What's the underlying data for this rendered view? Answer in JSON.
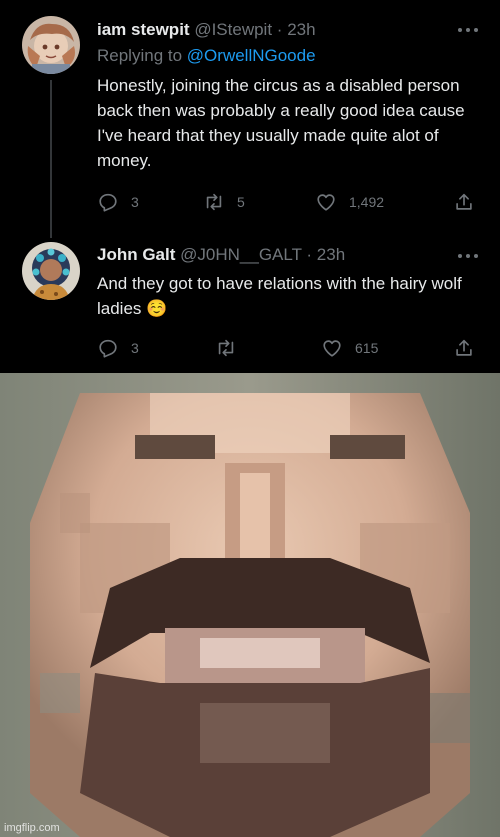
{
  "tweets": [
    {
      "name": "iam stewpit",
      "handle": "@IStewpit",
      "sep": "·",
      "time": "23h",
      "replying_prefix": "Replying to",
      "replying_to": "@OrwellNGoode",
      "text": "Honestly, joining the circus as a disabled person back then was probably a really good idea cause I've heard that they usually made quite alot of money.",
      "replies": "3",
      "retweets": "5",
      "likes": "1,492"
    },
    {
      "name": "John Galt",
      "handle": "@J0HN__GALT",
      "sep": "·",
      "time": "23h",
      "text": "And they got to have relations with the hairy wolf ladies ☺️",
      "replies": "3",
      "retweets": "",
      "likes": "615"
    }
  ],
  "colors": {
    "background": "#000000",
    "text": "#e7e9ea",
    "muted": "#71767b",
    "link": "#1d9bf0"
  },
  "icons": [
    "reply-icon",
    "retweet-icon",
    "like-icon",
    "share-icon",
    "more-icon"
  ],
  "watermark": "imgflip.com"
}
